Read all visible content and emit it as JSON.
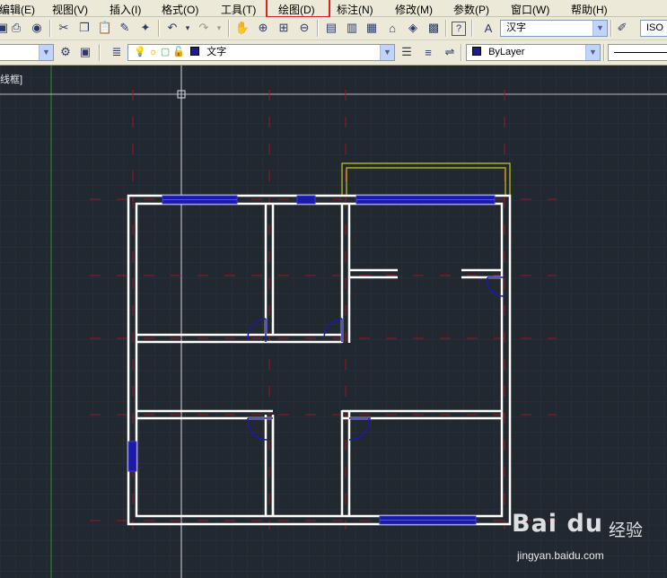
{
  "menubar": {
    "items": [
      "编辑(E)",
      "视图(V)",
      "插入(I)",
      "格式(O)",
      "工具(T)",
      "绘图(D)",
      "标注(N)",
      "修改(M)",
      "参数(P)",
      "窗口(W)",
      "帮助(H)"
    ],
    "highlighted": "绘图(D)",
    "highlight_color": "#e02020"
  },
  "toolbar1": {
    "text_style": "汉字",
    "dim_style": "ISO"
  },
  "toolbar2": {
    "layer": "文字",
    "color": "ByLayer"
  },
  "viewport": {
    "label": "线框]"
  },
  "drawing": {
    "wall_color": "#ffffff",
    "window_color": "#1a1aa8",
    "door_color": "#1a1ab0",
    "centerline_color": "#a0161c",
    "outline_color": "#c8c820",
    "grid_color": "#2c3440"
  },
  "watermark": {
    "logo": "Bai du",
    "cn": "经验",
    "url": "jingyan.baidu.com"
  }
}
